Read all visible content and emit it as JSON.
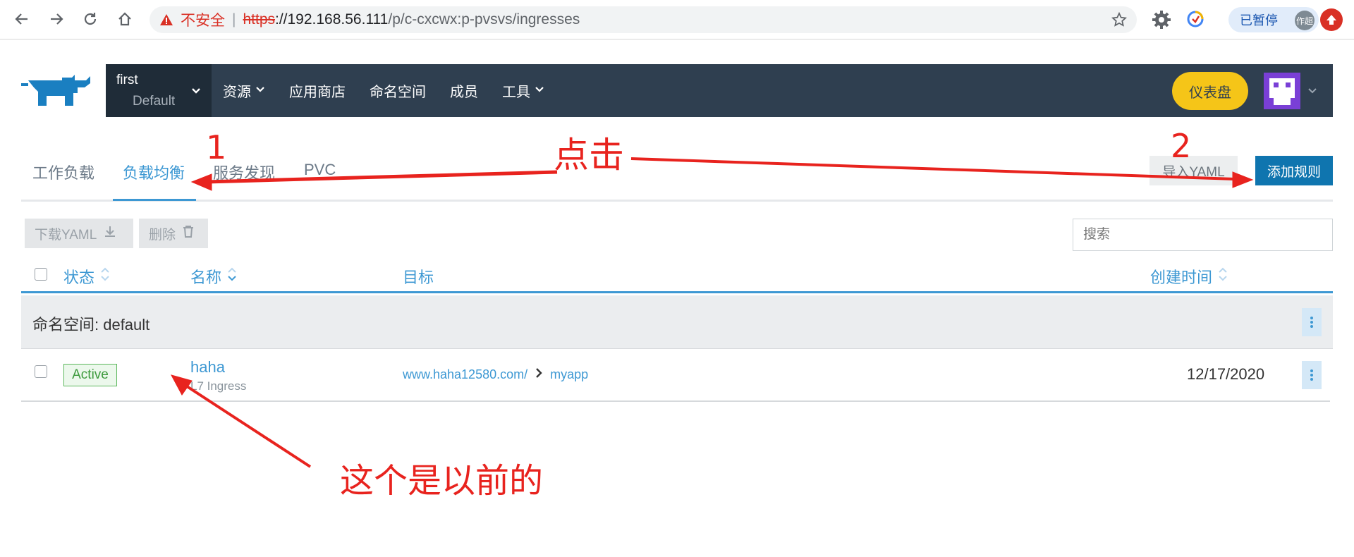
{
  "browser": {
    "insecure_label": "不安全",
    "url_scheme": "https",
    "url_host": "://192.168.56.111",
    "url_path": "/p/c-cxcwx:p-pvsvs/ingresses",
    "paused_label": "已暂停",
    "profile_label": "作超"
  },
  "header": {
    "cluster_name": "first",
    "project_name": "Default",
    "menu": [
      {
        "label": "资源"
      },
      {
        "label": "应用商店"
      },
      {
        "label": "命名空间"
      },
      {
        "label": "成员"
      },
      {
        "label": "工具"
      }
    ],
    "dashboard_label": "仪表盘"
  },
  "tabs": [
    {
      "label": "工作负载"
    },
    {
      "label": "负载均衡"
    },
    {
      "label": "服务发现"
    },
    {
      "label": "PVC"
    }
  ],
  "actions": {
    "import_yaml": "导入YAML",
    "add_rule": "添加规则",
    "download_yaml": "下载YAML",
    "delete": "删除",
    "search_placeholder": "搜索"
  },
  "table": {
    "columns": [
      "状态",
      "名称",
      "目标",
      "创建时间"
    ],
    "group_label": "命名空间: default",
    "rows": [
      {
        "status": "Active",
        "name": "haha",
        "type": "L7 Ingress",
        "target_host": "www.haha12580.com/",
        "target_service": "myapp",
        "created": "12/17/2020"
      }
    ]
  },
  "annotations": {
    "click": "点击",
    "step1": "1",
    "step2": "2",
    "note": "这个是以前的"
  },
  "colors": {
    "nav_bg": "#2f3f50",
    "accent": "#3d98d3",
    "primary_button": "#0f75af",
    "dashboard_button": "#f5c518",
    "active_badge": "#5cb85c",
    "annotation": "#e8231e"
  }
}
